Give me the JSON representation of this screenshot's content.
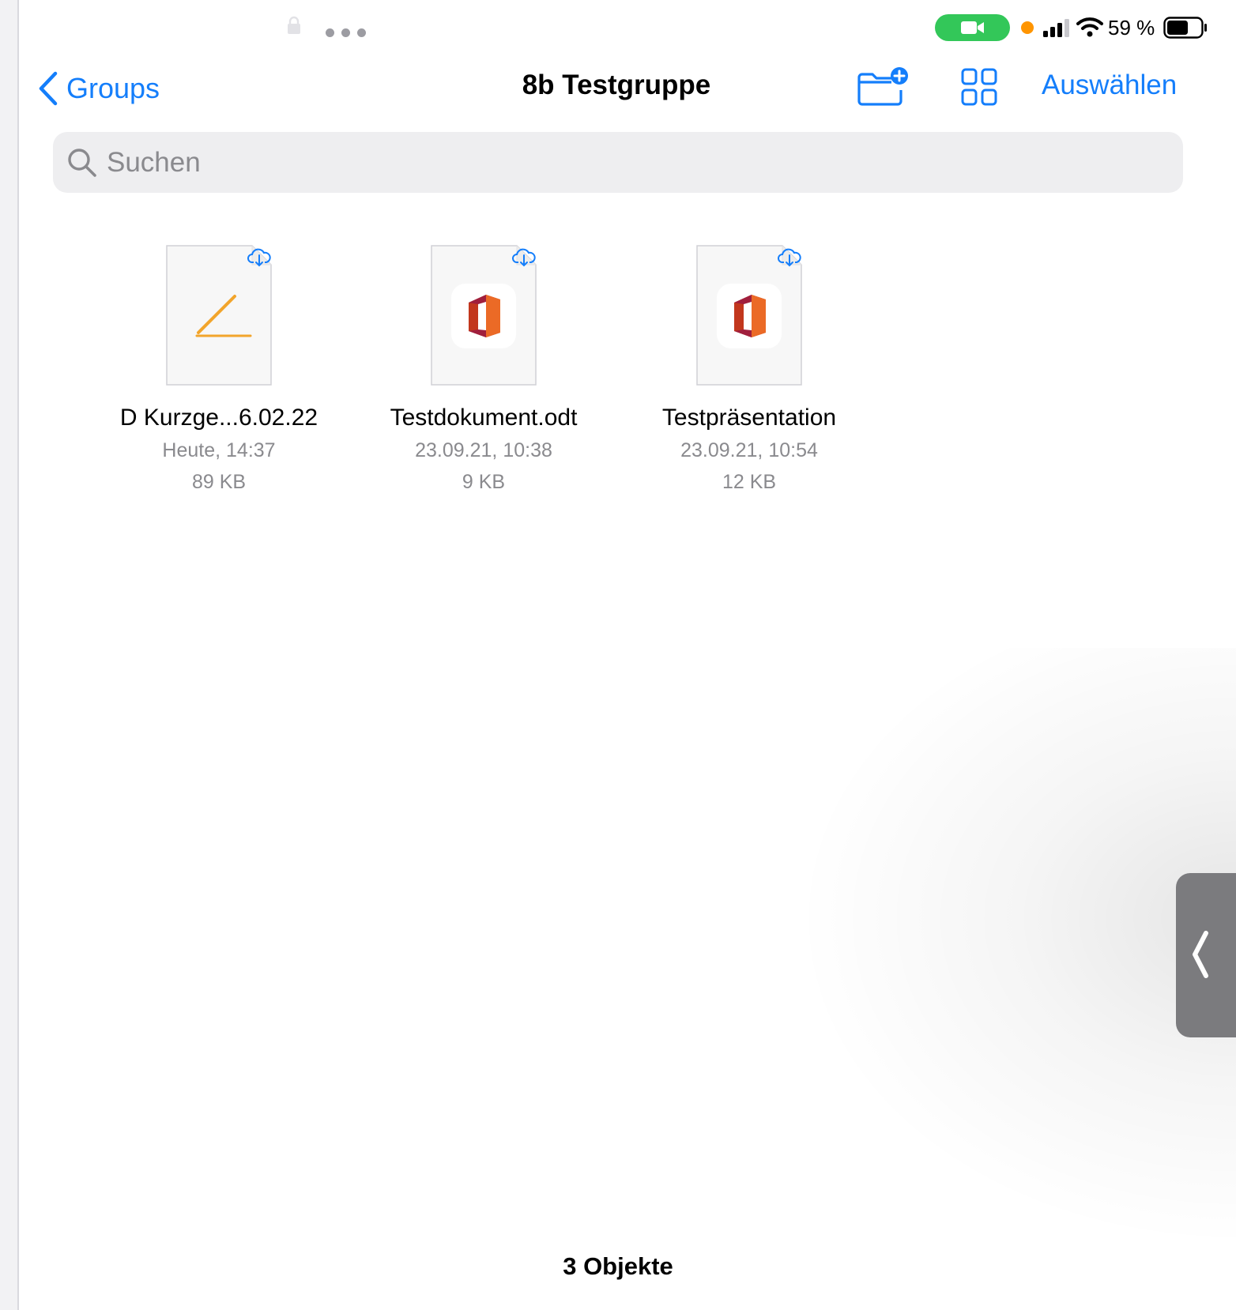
{
  "status_bar": {
    "battery_percent": "59 %",
    "icons": [
      "lock-icon",
      "multitasking-dots-icon",
      "facetime-video-icon",
      "mic-indicator-dot",
      "cellular-signal-icon",
      "wifi-icon",
      "battery-icon"
    ],
    "battery_level": 0.59,
    "colors": {
      "facetime_pill": "#33c759",
      "indicator_dot": "#ff9500"
    }
  },
  "nav": {
    "back_label": "Groups",
    "title": "8b Testgruppe",
    "select_label": "Auswählen",
    "accent_color": "#147efb",
    "icons": [
      "chevron-left-icon",
      "new-folder-icon",
      "grid-view-icon"
    ]
  },
  "search": {
    "placeholder": "Suchen"
  },
  "files": [
    {
      "name": "D Kurzge...6.02.22",
      "date": "Heute, 14:37",
      "size": "89 KB",
      "icon": "pages-pencil-icon",
      "cloud": true
    },
    {
      "name": "Testdokument.odt",
      "date": "23.09.21, 10:38",
      "size": "9 KB",
      "icon": "office-icon",
      "cloud": true
    },
    {
      "name": "Testpräsentation",
      "date": "23.09.21, 10:54",
      "size": "12 KB",
      "icon": "office-icon",
      "cloud": true
    }
  ],
  "footer": {
    "count_label": "3 Objekte"
  },
  "side_handle": {
    "icon": "chevron-left-icon"
  }
}
